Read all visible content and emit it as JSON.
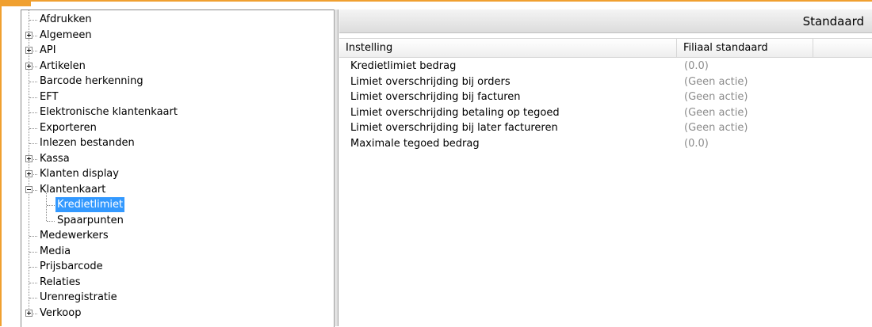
{
  "accent_color": "#f0a030",
  "tree": {
    "items": [
      {
        "label": "Afdrukken",
        "expander": "none",
        "level": 0
      },
      {
        "label": "Algemeen",
        "expander": "plus",
        "level": 0
      },
      {
        "label": "API",
        "expander": "plus",
        "level": 0
      },
      {
        "label": "Artikelen",
        "expander": "plus",
        "level": 0
      },
      {
        "label": "Barcode herkenning",
        "expander": "none",
        "level": 0
      },
      {
        "label": "EFT",
        "expander": "none",
        "level": 0
      },
      {
        "label": "Elektronische klantenkaart",
        "expander": "none",
        "level": 0
      },
      {
        "label": "Exporteren",
        "expander": "none",
        "level": 0
      },
      {
        "label": "Inlezen bestanden",
        "expander": "none",
        "level": 0
      },
      {
        "label": "Kassa",
        "expander": "plus",
        "level": 0
      },
      {
        "label": "Klanten display",
        "expander": "plus",
        "level": 0
      },
      {
        "label": "Klantenkaart",
        "expander": "minus",
        "level": 0
      },
      {
        "label": "Kredietlimiet",
        "expander": "none",
        "level": 1,
        "selected": true
      },
      {
        "label": "Spaarpunten",
        "expander": "none",
        "level": 1
      },
      {
        "label": "Medewerkers",
        "expander": "none",
        "level": 0
      },
      {
        "label": "Media",
        "expander": "none",
        "level": 0
      },
      {
        "label": "Prijsbarcode",
        "expander": "none",
        "level": 0
      },
      {
        "label": "Relaties",
        "expander": "none",
        "level": 0
      },
      {
        "label": "Urenregistratie",
        "expander": "none",
        "level": 0
      },
      {
        "label": "Verkoop",
        "expander": "plus",
        "level": 0
      }
    ]
  },
  "settings": {
    "title": "Standaard",
    "columns": [
      "Instelling",
      "Filiaal standaard"
    ],
    "rows": [
      {
        "name": "Kredietlimiet bedrag",
        "value": "(0.0)"
      },
      {
        "name": "Limiet overschrijding bij orders",
        "value": "(Geen actie)"
      },
      {
        "name": "Limiet overschrijding bij facturen",
        "value": "(Geen actie)"
      },
      {
        "name": "Limiet overschrijding betaling op tegoed",
        "value": "(Geen actie)"
      },
      {
        "name": "Limiet overschrijding bij later factureren",
        "value": "(Geen actie)"
      },
      {
        "name": "Maximale tegoed bedrag",
        "value": "(0.0)"
      }
    ]
  }
}
